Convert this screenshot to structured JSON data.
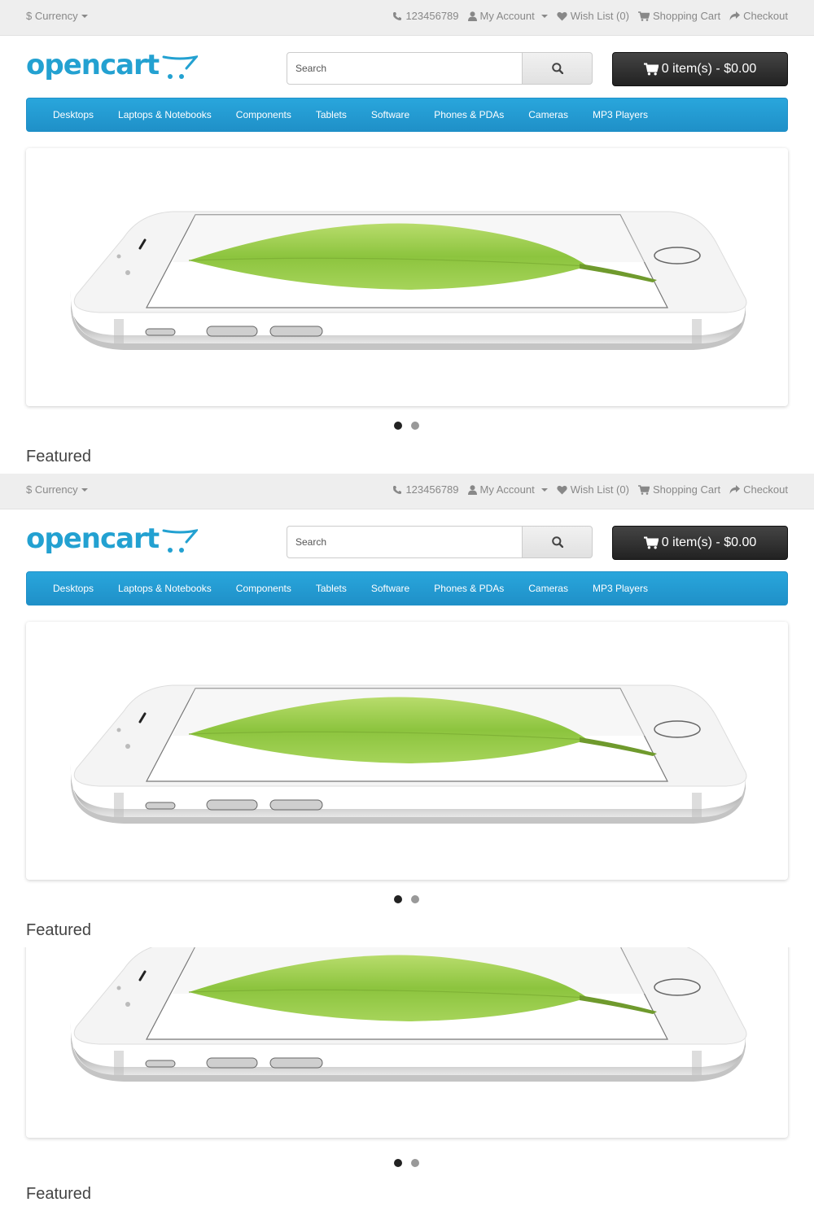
{
  "topbar": {
    "currency_label": "$ Currency",
    "phone": "123456789",
    "my_account": "My Account",
    "wish_list": "Wish List (0)",
    "shopping_cart": "Shopping Cart",
    "checkout": "Checkout"
  },
  "logo": {
    "text": "opencart",
    "color": "#23a1d1"
  },
  "search": {
    "placeholder": "Search"
  },
  "cart": {
    "label": "0 item(s) - $0.00"
  },
  "menu": {
    "items": [
      "Desktops",
      "Laptops & Notebooks",
      "Components",
      "Tablets",
      "Software",
      "Phones & PDAs",
      "Cameras",
      "MP3 Players"
    ]
  },
  "slideshow": {
    "active_index": 0,
    "slide_count": 2
  },
  "section": {
    "featured_title": "Featured"
  },
  "colors": {
    "menu_bg": "#229ac8",
    "cart_bg": "#303030",
    "topbar_bg": "#eeeeee"
  },
  "icons": [
    "phone-icon",
    "user-icon",
    "heart-icon",
    "cart-icon",
    "share-icon",
    "search-icon"
  ]
}
